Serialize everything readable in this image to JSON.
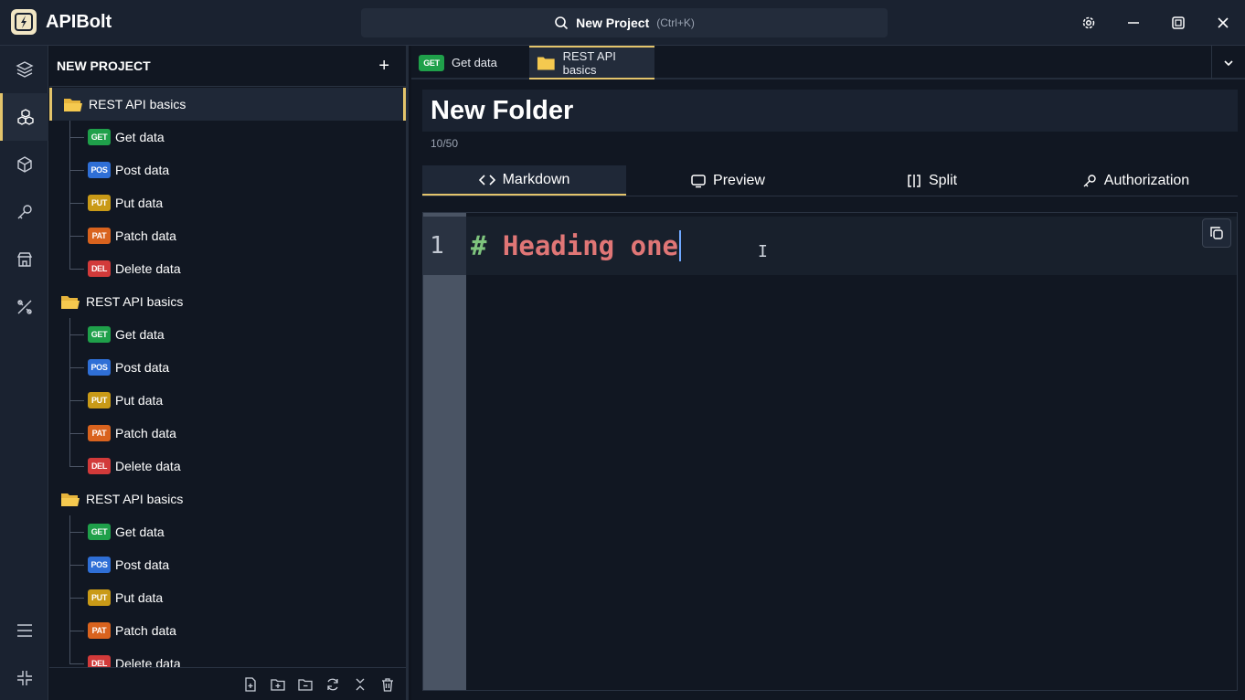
{
  "app": {
    "name": "APIBolt"
  },
  "search": {
    "text": "New Project",
    "shortcut": "(Ctrl+K)"
  },
  "colors": {
    "accent": "#e3c46b",
    "get": "#1fa04a",
    "post": "#2f6fd6",
    "put": "#c99a17",
    "patch": "#d9631e",
    "delete": "#d23a3a"
  },
  "sidebar": {
    "title": "NEW PROJECT",
    "folders": [
      {
        "label": "REST API basics",
        "requests": [
          {
            "method": "GET",
            "label": "Get data"
          },
          {
            "method": "POS",
            "label": "Post data"
          },
          {
            "method": "PUT",
            "label": "Put data"
          },
          {
            "method": "PAT",
            "label": "Patch data"
          },
          {
            "method": "DEL",
            "label": "Delete data"
          }
        ]
      },
      {
        "label": "REST API basics",
        "requests": [
          {
            "method": "GET",
            "label": "Get data"
          },
          {
            "method": "POS",
            "label": "Post data"
          },
          {
            "method": "PUT",
            "label": "Put data"
          },
          {
            "method": "PAT",
            "label": "Patch data"
          },
          {
            "method": "DEL",
            "label": "Delete data"
          }
        ]
      },
      {
        "label": "REST API basics",
        "requests": [
          {
            "method": "GET",
            "label": "Get data"
          },
          {
            "method": "POS",
            "label": "Post data"
          },
          {
            "method": "PUT",
            "label": "Put data"
          },
          {
            "method": "PAT",
            "label": "Patch data"
          },
          {
            "method": "DEL",
            "label": "Delete data"
          }
        ]
      }
    ]
  },
  "tabs": [
    {
      "method": "GET",
      "label": "Get data"
    },
    {
      "label": "REST API basics"
    }
  ],
  "editor": {
    "title": "New Folder",
    "char_count": "10/50",
    "view_tabs": [
      {
        "label": "Markdown"
      },
      {
        "label": "Preview"
      },
      {
        "label": "Split"
      },
      {
        "label": "Authorization"
      }
    ],
    "line_number": "1",
    "code_hash": "#",
    "code_text": " Heading one"
  }
}
